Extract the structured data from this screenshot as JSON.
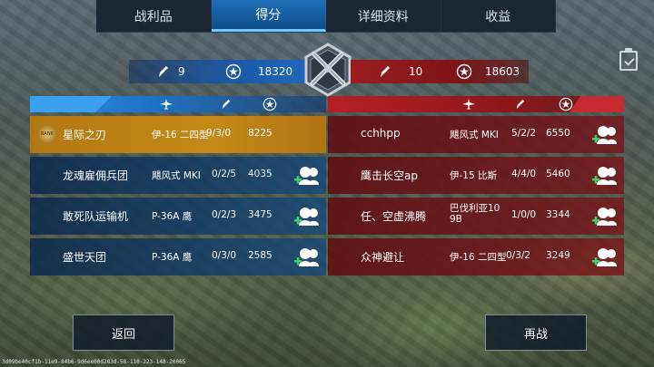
{
  "tabs": [
    "战利品",
    "得分",
    "详细资料",
    "收益"
  ],
  "active_tab": 1,
  "summary": {
    "blue": {
      "kills": "9",
      "score": "18320"
    },
    "red": {
      "kills": "10",
      "score": "18603"
    }
  },
  "blue_team": [
    {
      "name": "星际之刃",
      "plane": "伊-16 二四型",
      "kda": "9/3/0",
      "score": "8225",
      "badge_text": "RANK",
      "self": true
    },
    {
      "name": "龙魂雇佣兵团",
      "plane": "飓风式 MKⅠ",
      "kda": "0/2/5",
      "score": "4035"
    },
    {
      "name": "敢死队运输机",
      "plane": "P-36A 鹰",
      "kda": "0/2/3",
      "score": "3475"
    },
    {
      "name": "盛世天团",
      "plane": "P-36A 鹰",
      "kda": "0/3/0",
      "score": "2585"
    }
  ],
  "red_team": [
    {
      "name": "cchhpp",
      "plane": "飓风式 MKⅠ",
      "kda": "5/2/2",
      "score": "6550"
    },
    {
      "name": "鹰击长空ap",
      "plane": "伊-15 比斯",
      "kda": "4/4/0",
      "score": "5460"
    },
    {
      "name": "任、空虚沸腾",
      "plane": "巴伐利亚10\n9B",
      "kda": "1/0/0",
      "score": "3344"
    },
    {
      "name": "众神避让",
      "plane": "伊-16 二四型",
      "kda": "0/3/2",
      "score": "3249"
    }
  ],
  "buttons": {
    "back": "返回",
    "again": "再战"
  },
  "debug_text": "3d09be40cf1b-11e9-84b6-9d6ee00d283d-58-110-223-148-20065",
  "colors": {
    "blue": "#1f66bd",
    "red": "#a01c20",
    "gold": "#c48a18"
  }
}
